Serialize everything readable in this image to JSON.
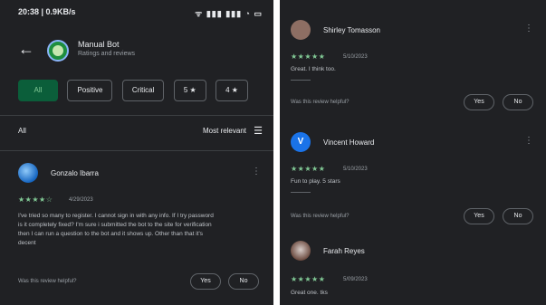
{
  "status": {
    "time": "20:38 | 0.9KB/s",
    "icons": "ᯤ ▮▮▮ ▮▮▮ ◔ ▭"
  },
  "app": {
    "name": "Manual Bot",
    "sub": "Ratings and reviews"
  },
  "chips": [
    "All",
    "Positive",
    "Critical",
    "5 ★",
    "4 ★"
  ],
  "filter": {
    "label": "All",
    "sort": "Most relevant"
  },
  "reviews_left": [
    {
      "name": "Gonzalo Ibarra",
      "stars": "★★★★☆",
      "date": "4/29/2023",
      "text": [
        "I've tried so many to register. I cannot sign in with any info. If I try password",
        "is it completely fixed? I'm sure i submitted the bot to the site for verification",
        "then I can run a question to the bot and it shows up. Other than that it's",
        "decent"
      ],
      "helpful": "Was this review helpful?",
      "yes": "Yes",
      "no": "No"
    }
  ],
  "reviews_right": [
    {
      "name": "Shirley Tomasson",
      "stars": "★★★★★",
      "date": "5/10/2023",
      "text": "Great. I think too.",
      "helpful": "Was this review helpful?",
      "yes": "Yes",
      "no": "No",
      "avatar_letter": "",
      "avatar_color": "#8d6e63"
    },
    {
      "name": "Vincent Howard",
      "stars": "★★★★★",
      "date": "5/10/2023",
      "text": "Fun to play. 5 stars",
      "helpful": "Was this review helpful?",
      "yes": "Yes",
      "no": "No",
      "avatar_letter": "V",
      "avatar_color": "#1a73e8"
    },
    {
      "name": "Farah Reyes",
      "stars": "★★★★★",
      "date": "5/09/2023",
      "text": "Great one. tks",
      "avatar_letter": "",
      "avatar_color": "#a1887f"
    }
  ],
  "colors": {
    "background": "#202124",
    "accent": "#81c995",
    "chip_active": "#0b5e3a"
  }
}
